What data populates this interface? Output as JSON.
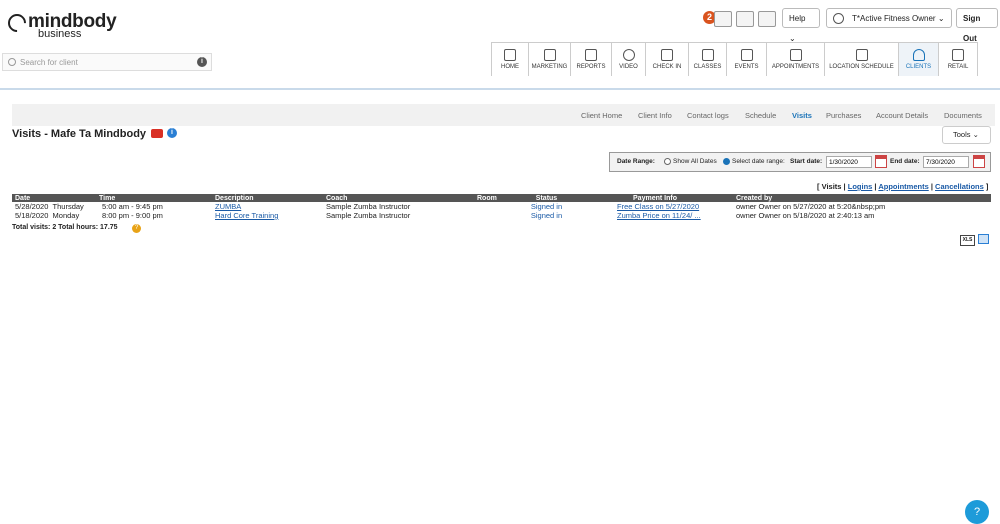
{
  "brand": {
    "name": "mindbody",
    "sub": "business"
  },
  "topbar": {
    "notification_count": "2",
    "help_label": "Help",
    "location_label": "T*Active Fitness Owner",
    "signout_label": "Sign Out"
  },
  "search": {
    "placeholder": "Search for client",
    "info_glyph": "i"
  },
  "nav": {
    "items": [
      {
        "label": "HOME",
        "icon": "home-icon"
      },
      {
        "label": "MARKETING",
        "icon": "megaphone-icon"
      },
      {
        "label": "REPORTS",
        "icon": "bar-chart-icon"
      },
      {
        "label": "VIDEO",
        "icon": "play-icon"
      },
      {
        "label": "CHECK IN",
        "icon": "person-add-icon"
      },
      {
        "label": "CLASSES",
        "icon": "calendar-icon"
      },
      {
        "label": "EVENTS",
        "icon": "calendar-icon"
      },
      {
        "label": "APPOINTMENTS",
        "icon": "calendar-grid-icon"
      },
      {
        "label": "LOCATION SCHEDULE",
        "icon": "door-icon"
      },
      {
        "label": "CLIENTS",
        "icon": "person-icon"
      },
      {
        "label": "RETAIL",
        "icon": "bag-icon"
      }
    ],
    "active": "CLIENTS"
  },
  "subnav": {
    "items": [
      "Client Home",
      "Client Info",
      "Contact logs",
      "Schedule",
      "Visits",
      "Purchases",
      "Account Details",
      "Documents"
    ],
    "active": "Visits"
  },
  "page": {
    "title": "Visits - Mafe Ta Mindbody",
    "tools_label": "Tools"
  },
  "daterange": {
    "label": "Date Range:",
    "opt_all": "Show All Dates",
    "opt_select": "Select date range:",
    "start_label": "Start date:",
    "start_value": "1/30/2020",
    "end_label": "End date:",
    "end_value": "7/30/2020"
  },
  "links": {
    "visits": "Visits",
    "logins": "Logins",
    "appointments": "Appointments",
    "cancellations": "Cancellations"
  },
  "table": {
    "headers": [
      "Date",
      "Time",
      "Description",
      "Coach",
      "Room",
      "Status",
      "Payment Info",
      "Created by"
    ],
    "rows": [
      {
        "date": "5/28/2020",
        "day": "Thursday",
        "time": "5:00 am - 9:45 pm",
        "description": "ZUMBA",
        "coach": "Sample Zumba Instructor",
        "room": "",
        "status": "Signed in",
        "payment": "Free Class on 5/27/2020",
        "created": "owner Owner on 5/27/2020 at 5:20&nbsp;pm"
      },
      {
        "date": "5/18/2020",
        "day": "Monday",
        "time": "8:00 pm - 9:00 pm",
        "description": "Hard Core Training",
        "coach": "Sample Zumba Instructor",
        "room": "",
        "status": "Signed in",
        "payment": "Zumba Price on 11/24/ ...",
        "created": "owner Owner on 5/18/2020 at 2:40:13 am"
      }
    ]
  },
  "totals": {
    "text": "Total visits: 2  Total hours: 17.75"
  },
  "export": {
    "xls_label": "XLS"
  },
  "help_fab": "?",
  "colors": {
    "accent": "#1a73b8",
    "header_bg": "#555555",
    "badge": "#d9531e"
  }
}
